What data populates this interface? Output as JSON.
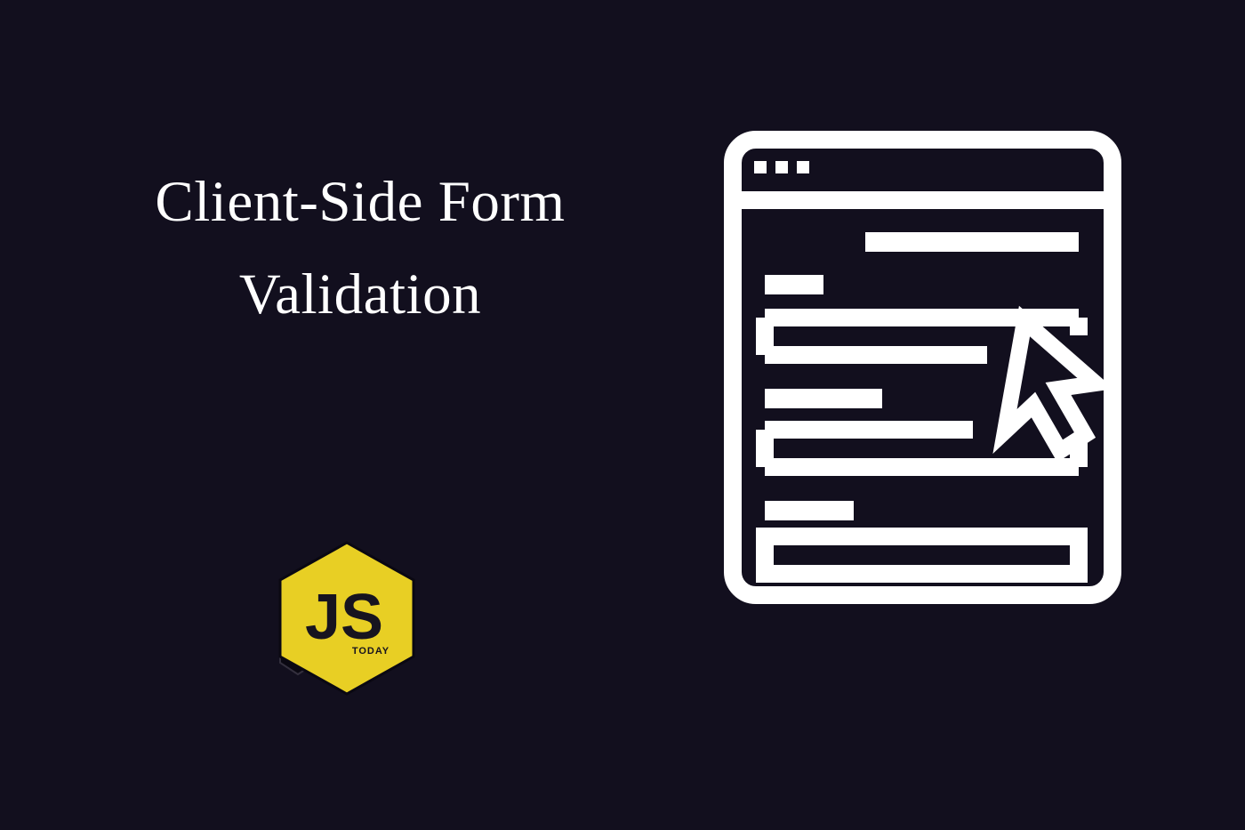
{
  "title": {
    "line1": "Client-Side Form",
    "line2": "Validation"
  },
  "logo": {
    "text_main": "JS",
    "text_sub": "TODAY",
    "colors": {
      "hex_fill": "#e8cf24",
      "text_fill": "#17141f"
    }
  },
  "colors": {
    "background": "#120f1e",
    "foreground": "#ffffff"
  }
}
